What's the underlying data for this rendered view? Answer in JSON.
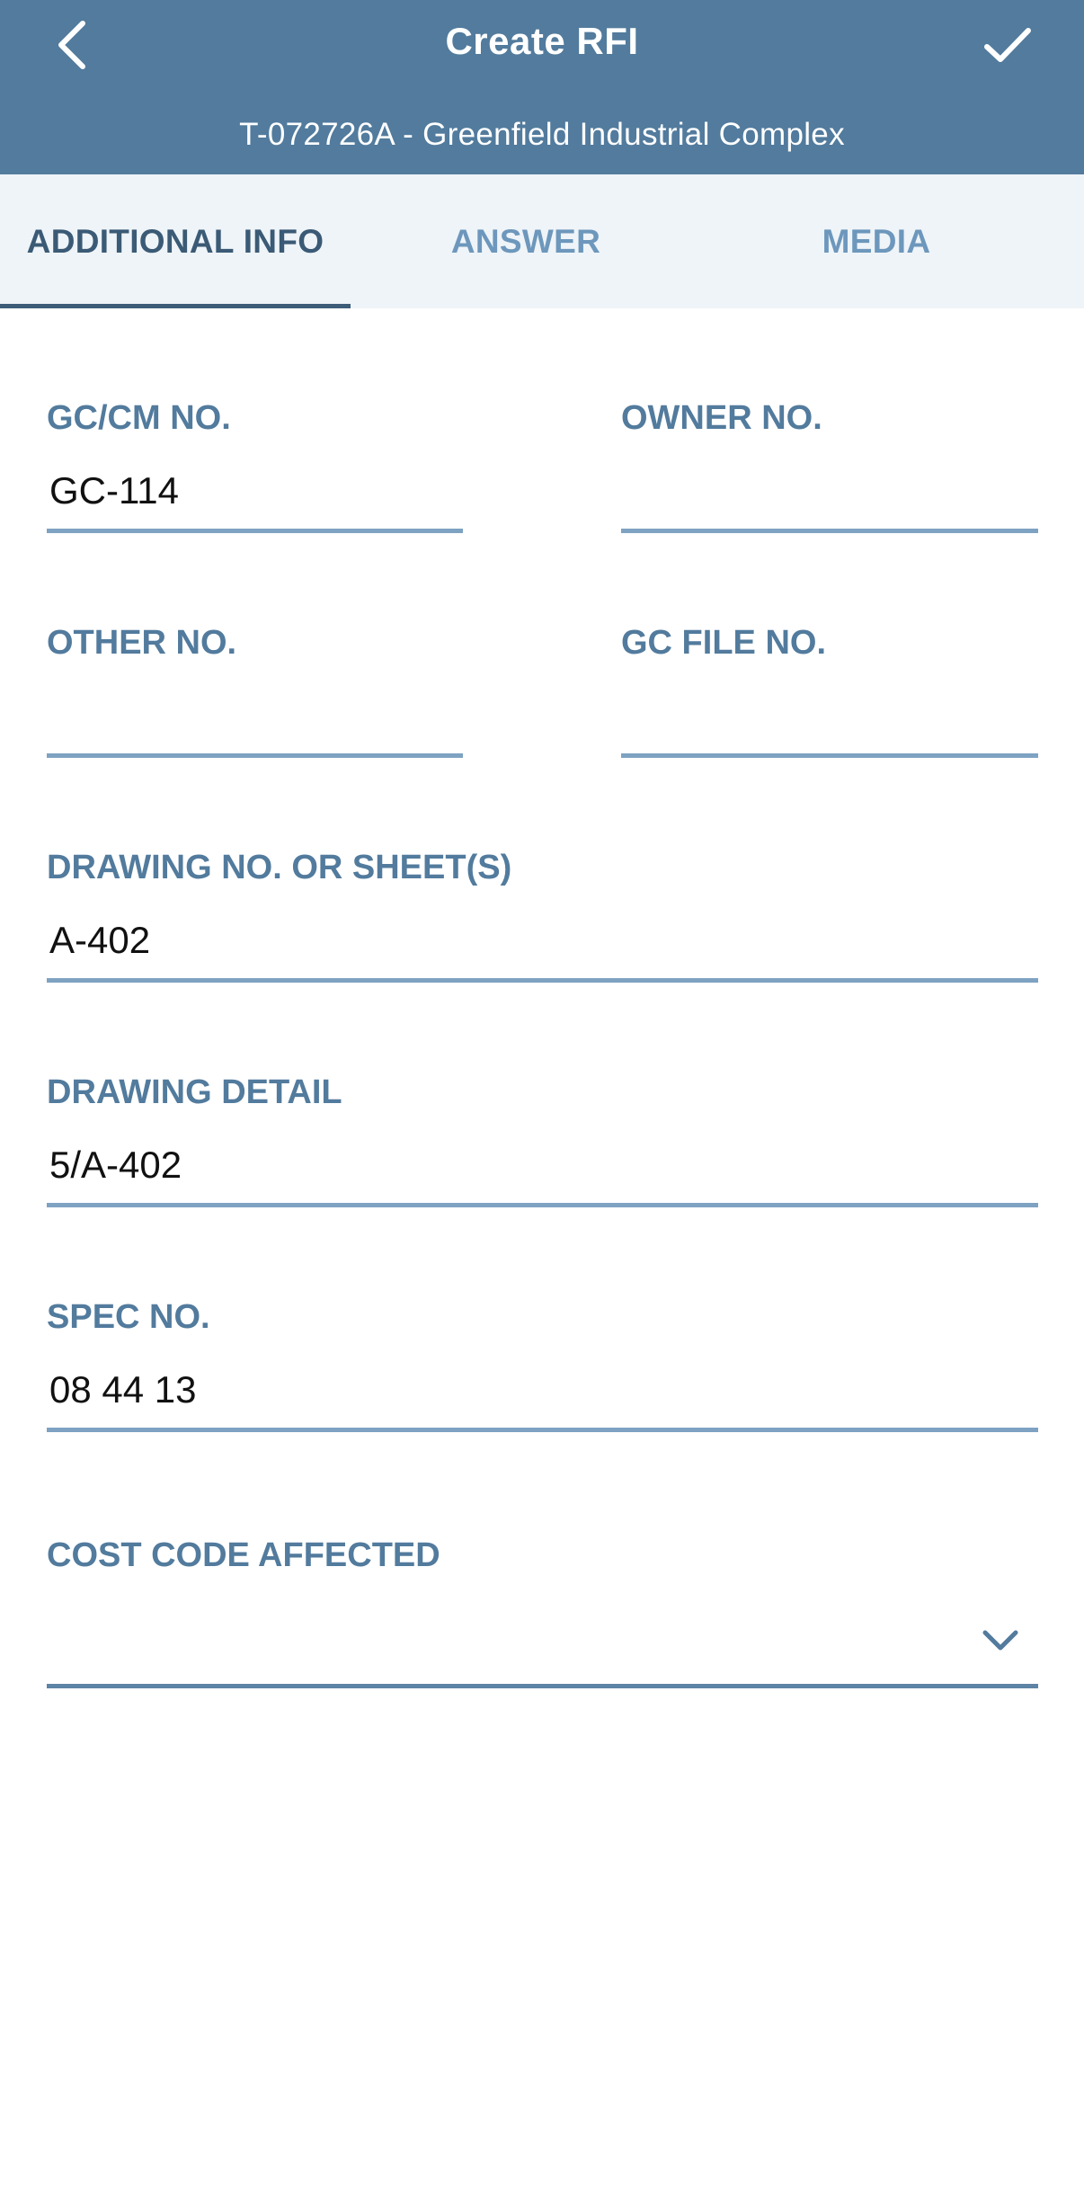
{
  "header": {
    "title": "Create RFI",
    "subtitle": "T-072726A - Greenfield Industrial Complex",
    "background_color": "#527b9d"
  },
  "tabs": [
    {
      "label": "ADDITIONAL INFO",
      "active": true
    },
    {
      "label": "ANSWER",
      "active": false
    },
    {
      "label": "MEDIA",
      "active": false
    }
  ],
  "form": {
    "gc_cm_no": {
      "label": "GC/CM NO.",
      "value": "GC-114"
    },
    "owner_no": {
      "label": "OWNER NO.",
      "value": ""
    },
    "other_no": {
      "label": "OTHER NO.",
      "value": ""
    },
    "gc_file_no": {
      "label": "GC FILE NO.",
      "value": ""
    },
    "drawing_no": {
      "label": "DRAWING NO. OR SHEET(S)",
      "value": "A-402"
    },
    "drawing_detail": {
      "label": "DRAWING DETAIL",
      "value": "5/A-402"
    },
    "spec_no": {
      "label": "SPEC NO.",
      "value": "08 44 13"
    },
    "cost_code": {
      "label": "COST CODE AFFECTED",
      "value": ""
    }
  },
  "icons": {
    "back": "chevron-left-icon",
    "save": "checkmark-icon",
    "dropdown": "chevron-down-icon"
  }
}
